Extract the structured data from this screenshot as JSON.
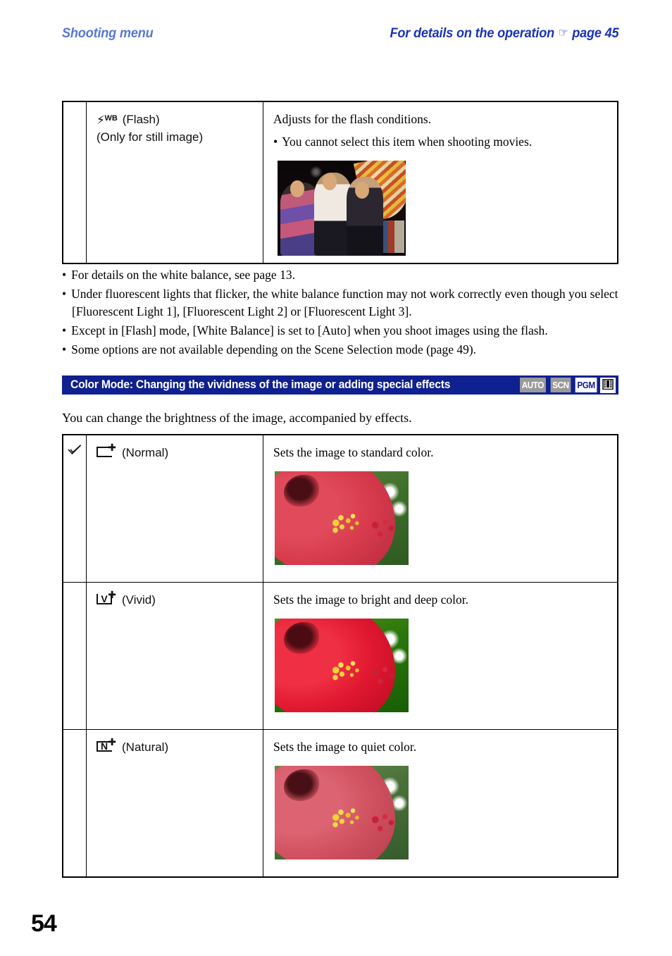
{
  "running_head": {
    "left": "Shooting menu",
    "right_text": "For details on the operation",
    "right_icon": "pointing-hand-icon",
    "right_page": "page 45"
  },
  "flash_table": {
    "rows": [
      {
        "check": "",
        "icon": "flash-wb-icon",
        "icon_glyph": "⚡",
        "icon_sup": "WB",
        "label_line1": "(Flash)",
        "label_line2": "(Only for still image)",
        "description": "Adjusts for the flash conditions.",
        "bullet": "You cannot select this item when shooting movies.",
        "photo": "night-party-photo"
      }
    ]
  },
  "notes": [
    "For details on the white balance, see page 13.",
    "Under fluorescent lights that flicker, the white balance function may not work correctly even though you select [Fluorescent Light 1], [Fluorescent Light 2] or [Fluorescent Light 3].",
    "Except in [Flash] mode, [White Balance] is set to [Auto] when you shoot images using the flash.",
    "Some options are not available depending on the Scene Selection mode (page 49)."
  ],
  "section": {
    "title": "Color Mode: Changing the vividness of the image or adding special effects",
    "badges": [
      {
        "label": "AUTO",
        "state": "off",
        "name": "mode-badge-auto"
      },
      {
        "label": "SCN",
        "state": "off",
        "name": "mode-badge-scn"
      },
      {
        "label": "PGM",
        "state": "on",
        "name": "mode-badge-pgm"
      },
      {
        "label": "🎞",
        "state": "movie",
        "name": "mode-badge-movie"
      }
    ]
  },
  "intro": "You can change the brightness of the image, accompanied by effects.",
  "color_table": {
    "rows": [
      {
        "check": "✓",
        "check_name": "default-check-icon",
        "icon_letter": "",
        "icon_name": "normal-color-icon",
        "label": "(Normal)",
        "description": "Sets the image to standard color.",
        "photo": "hibiscus-normal-photo",
        "photo_class": "normal"
      },
      {
        "check": "",
        "check_name": "",
        "icon_letter": "V",
        "icon_name": "vivid-color-icon",
        "label": "(Vivid)",
        "description": "Sets the image to bright and deep color.",
        "photo": "hibiscus-vivid-photo",
        "photo_class": "vivid"
      },
      {
        "check": "",
        "check_name": "",
        "icon_letter": "N",
        "icon_name": "natural-color-icon",
        "label": "(Natural)",
        "description": "Sets the image to quiet color.",
        "photo": "hibiscus-natural-photo",
        "photo_class": "natural"
      }
    ]
  },
  "folio": "54",
  "colors": {
    "header_left": "#5878d0",
    "header_right": "#1b34b4",
    "section_bar": "#0f2090",
    "badge_off": "#9a9a9a",
    "badge_on_text": "#0f2090"
  }
}
